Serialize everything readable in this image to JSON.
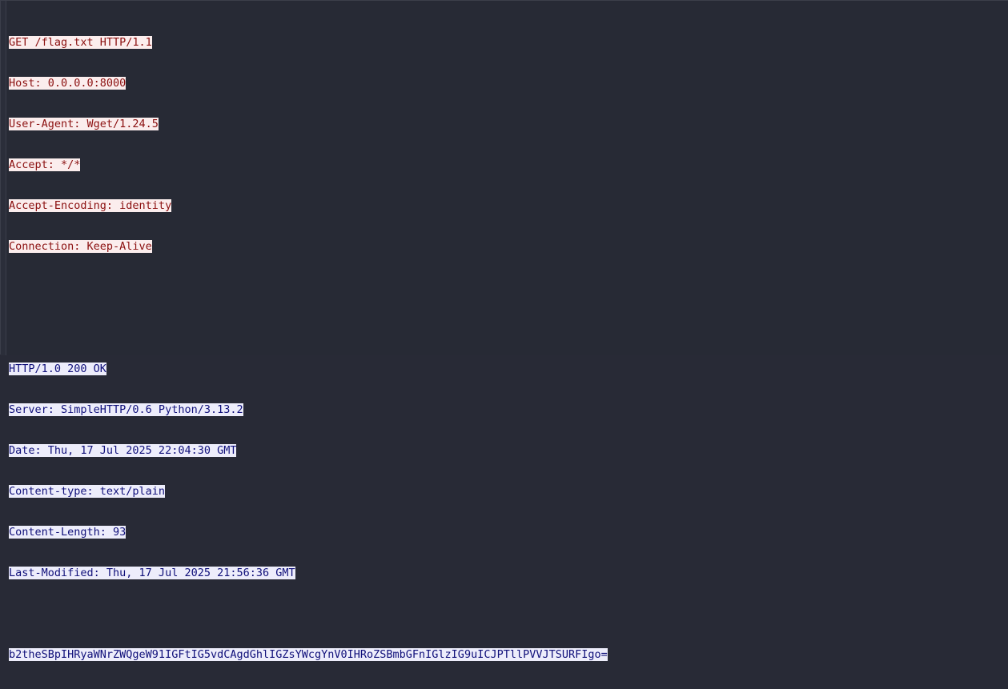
{
  "request": {
    "lines": [
      "GET /flag.txt HTTP/1.1",
      "Host: 0.0.0.0:8000",
      "User-Agent: Wget/1.24.5",
      "Accept: */*",
      "Accept-Encoding: identity",
      "Connection: Keep-Alive"
    ]
  },
  "response": {
    "lines": [
      "HTTP/1.0 200 OK",
      "Server: SimpleHTTP/0.6 Python/3.13.2",
      "Date: Thu, 17 Jul 2025 22:04:30 GMT",
      "Content-type: text/plain",
      "Content-Length: 93",
      "Last-Modified: Thu, 17 Jul 2025 21:56:36 GMT"
    ],
    "body": "b2theSBpIHRyaWNrZWQgeW91IGFtIG5vdCAgdGhlIGZsYWcgYnV0IHRoZSBmbGFnIGlzIG9uICJPTllPVVJTSURFIgo="
  },
  "colors": {
    "background": "#272a35",
    "request_bg": "#fbeded",
    "request_fg": "#8b1010",
    "response_bg": "#ededfb",
    "response_fg": "#10107a"
  }
}
